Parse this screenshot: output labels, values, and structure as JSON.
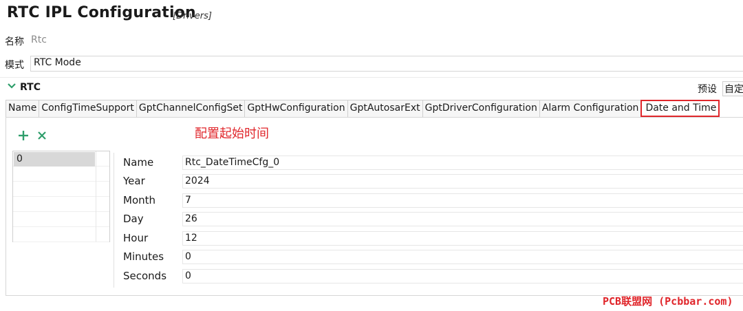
{
  "header": {
    "title": "RTC IPL Configuration",
    "subtitle": "[Drivers]"
  },
  "name_row": {
    "label": "名称",
    "value": "Rtc"
  },
  "mode_row": {
    "label": "模式",
    "value": "RTC Mode"
  },
  "section": {
    "title": "RTC",
    "preset_label": "预设",
    "custom_label": "自定义"
  },
  "tabs": [
    {
      "label": "Name"
    },
    {
      "label": "ConfigTimeSupport"
    },
    {
      "label": "GptChannelConfigSet"
    },
    {
      "label": "GptHwConfiguration"
    },
    {
      "label": "GptAutosarExt"
    },
    {
      "label": "GptDriverConfiguration"
    },
    {
      "label": "Alarm Configuration"
    },
    {
      "label": "Date and Time"
    }
  ],
  "active_tab": "Date and Time",
  "annotation": "配置起始时间",
  "instances": [
    {
      "label": "0"
    }
  ],
  "form": {
    "name": {
      "label": "Name",
      "value": "Rtc_DateTimeCfg_0"
    },
    "year": {
      "label": "Year",
      "value": "2024"
    },
    "month": {
      "label": "Month",
      "value": "7"
    },
    "day": {
      "label": "Day",
      "value": "26"
    },
    "hour": {
      "label": "Hour",
      "value": "12"
    },
    "minutes": {
      "label": "Minutes",
      "value": "0"
    },
    "seconds": {
      "label": "Seconds",
      "value": "0"
    }
  },
  "watermark": "PCB联盟网 (Pcbbar.com)",
  "colors": {
    "accent_red": "#e0262b",
    "icon_green": "#2e9e6b"
  }
}
